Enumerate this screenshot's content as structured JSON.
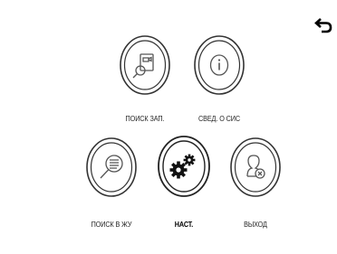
{
  "header": {
    "back_icon": "back-arrow-icon"
  },
  "menu": {
    "items": [
      {
        "id": "search-records",
        "label": "ПОИСК ЗАП.",
        "icon": "search-record-icon",
        "active": false
      },
      {
        "id": "system-info",
        "label": "СВЕД. О СИС",
        "icon": "info-icon",
        "active": false
      },
      {
        "id": "search-log",
        "label": "ПОИСК В ЖУ",
        "icon": "search-log-icon",
        "active": false
      },
      {
        "id": "settings",
        "label": "НАСТ.",
        "icon": "gears-icon",
        "active": true
      },
      {
        "id": "logout",
        "label": "ВЫХОД",
        "icon": "logout-user-icon",
        "active": false
      }
    ]
  },
  "colors": {
    "ring": "#333333",
    "background": "#ffffff",
    "icon": "#555555",
    "active_icon": "#111111"
  }
}
